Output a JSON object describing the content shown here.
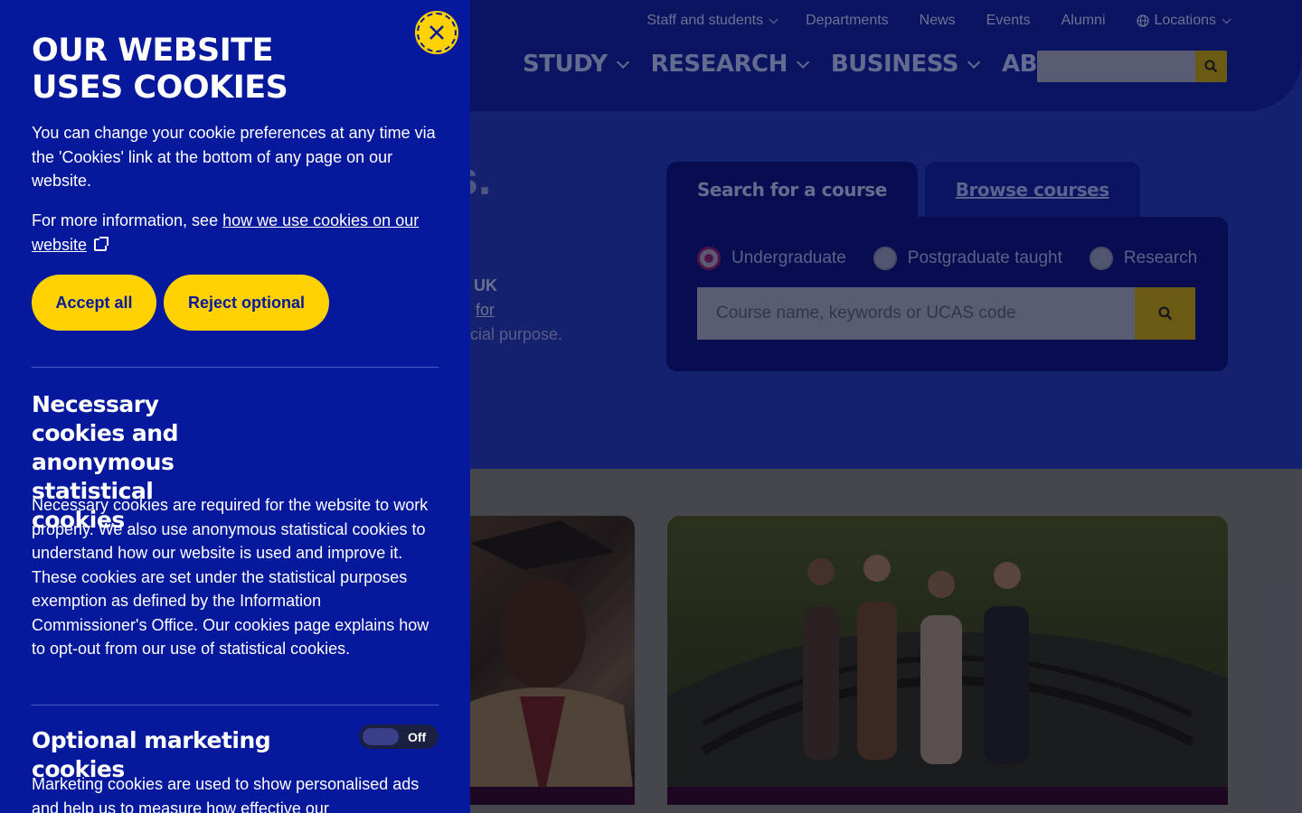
{
  "utility_nav": {
    "items": [
      "Staff and students",
      "Departments",
      "News",
      "Events",
      "Alumni",
      "Locations"
    ]
  },
  "main_nav": {
    "items": [
      "STUDY",
      "RESEARCH",
      "BUSINESS",
      "ABOUT"
    ]
  },
  "hero": {
    "fragment": "s.",
    "line1": "UK",
    "line2": "for",
    "line3": "cial purpose."
  },
  "course_search": {
    "tabs": [
      "Search for a course",
      "Browse courses"
    ],
    "radios": [
      "Undergraduate",
      "Postgraduate taught",
      "Research"
    ],
    "selected": "Undergraduate",
    "placeholder": "Course name, keywords or UCAS code"
  },
  "cookie_panel": {
    "title": "OUR WEBSITE USES COOKIES",
    "intro": "You can change your cookie preferences at any time via the 'Cookies' link at the bottom of any page on our website.",
    "more_prefix": "For more information, see ",
    "more_link": "how we use cookies on our website",
    "accept_label": "Accept all",
    "reject_label": "Reject optional",
    "necessary_title": "Necessary cookies and anonymous statistical cookies",
    "necessary_body": "Necessary cookies are required for the website to work properly. We also use anonymous statistical cookies to understand how our website is used and improve it. These cookies are set under the statistical purposes exemption as defined by the Information Commissioner's Office. Our cookies page explains how to opt-out from our use of statistical cookies.",
    "marketing_title": "Optional marketing cookies",
    "marketing_toggle": "Off",
    "marketing_body": "Marketing cookies are used to show personalised ads and help us to measure how effective our"
  },
  "colors": {
    "panel": "#06199c",
    "accent": "#ffd200"
  },
  "icons": [
    "close-icon",
    "search-icon",
    "globe-icon",
    "external-link-icon",
    "chevron-down-icon"
  ]
}
